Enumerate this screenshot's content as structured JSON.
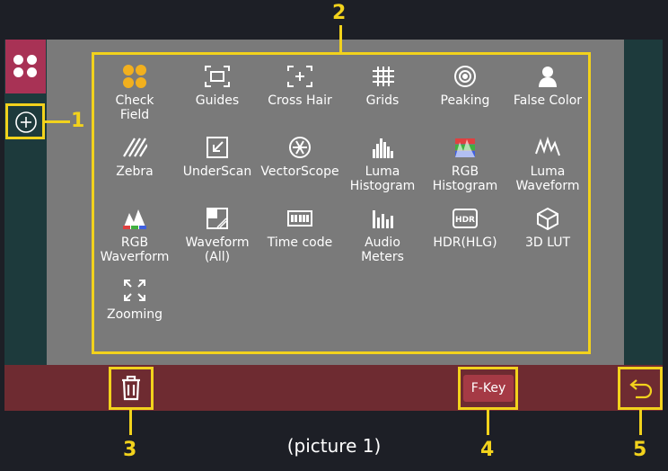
{
  "functions": [
    {
      "label": "Check\nField",
      "icon": "check-field-icon"
    },
    {
      "label": "Guides",
      "icon": "guides-icon"
    },
    {
      "label": "Cross Hair",
      "icon": "cross-hair-icon"
    },
    {
      "label": "Grids",
      "icon": "grids-icon"
    },
    {
      "label": "Peaking",
      "icon": "peaking-icon"
    },
    {
      "label": "False Color",
      "icon": "false-color-icon"
    },
    {
      "label": "Zebra",
      "icon": "zebra-icon"
    },
    {
      "label": "UnderScan",
      "icon": "underscan-icon"
    },
    {
      "label": "VectorScope",
      "icon": "vectorscope-icon"
    },
    {
      "label": "Luma\nHistogram",
      "icon": "luma-histogram-icon"
    },
    {
      "label": "RGB\nHistogram",
      "icon": "rgb-histogram-icon"
    },
    {
      "label": "Luma\nWaveform",
      "icon": "luma-waveform-icon"
    },
    {
      "label": "RGB\nWaverform",
      "icon": "rgb-waveform-icon"
    },
    {
      "label": "Waveform\n(All)",
      "icon": "waveform-all-icon"
    },
    {
      "label": "Time code",
      "icon": "timecode-icon"
    },
    {
      "label": "Audio\nMeters",
      "icon": "audio-meters-icon"
    },
    {
      "label": "HDR(HLG)",
      "icon": "hdr-icon"
    },
    {
      "label": "3D LUT",
      "icon": "3d-lut-icon"
    },
    {
      "label": "Zooming",
      "icon": "zooming-icon"
    }
  ],
  "bottom": {
    "fkey_label": "F-Key"
  },
  "callouts": {
    "c1": "1",
    "c2": "2",
    "c3": "3",
    "c4": "4",
    "c5": "5"
  },
  "caption": "(picture 1)",
  "colors": {
    "highlight": "#f2d21c",
    "bottom_bar": "#6e2b31",
    "app_icon": "#a83255",
    "panel": "#7a7a7a"
  }
}
